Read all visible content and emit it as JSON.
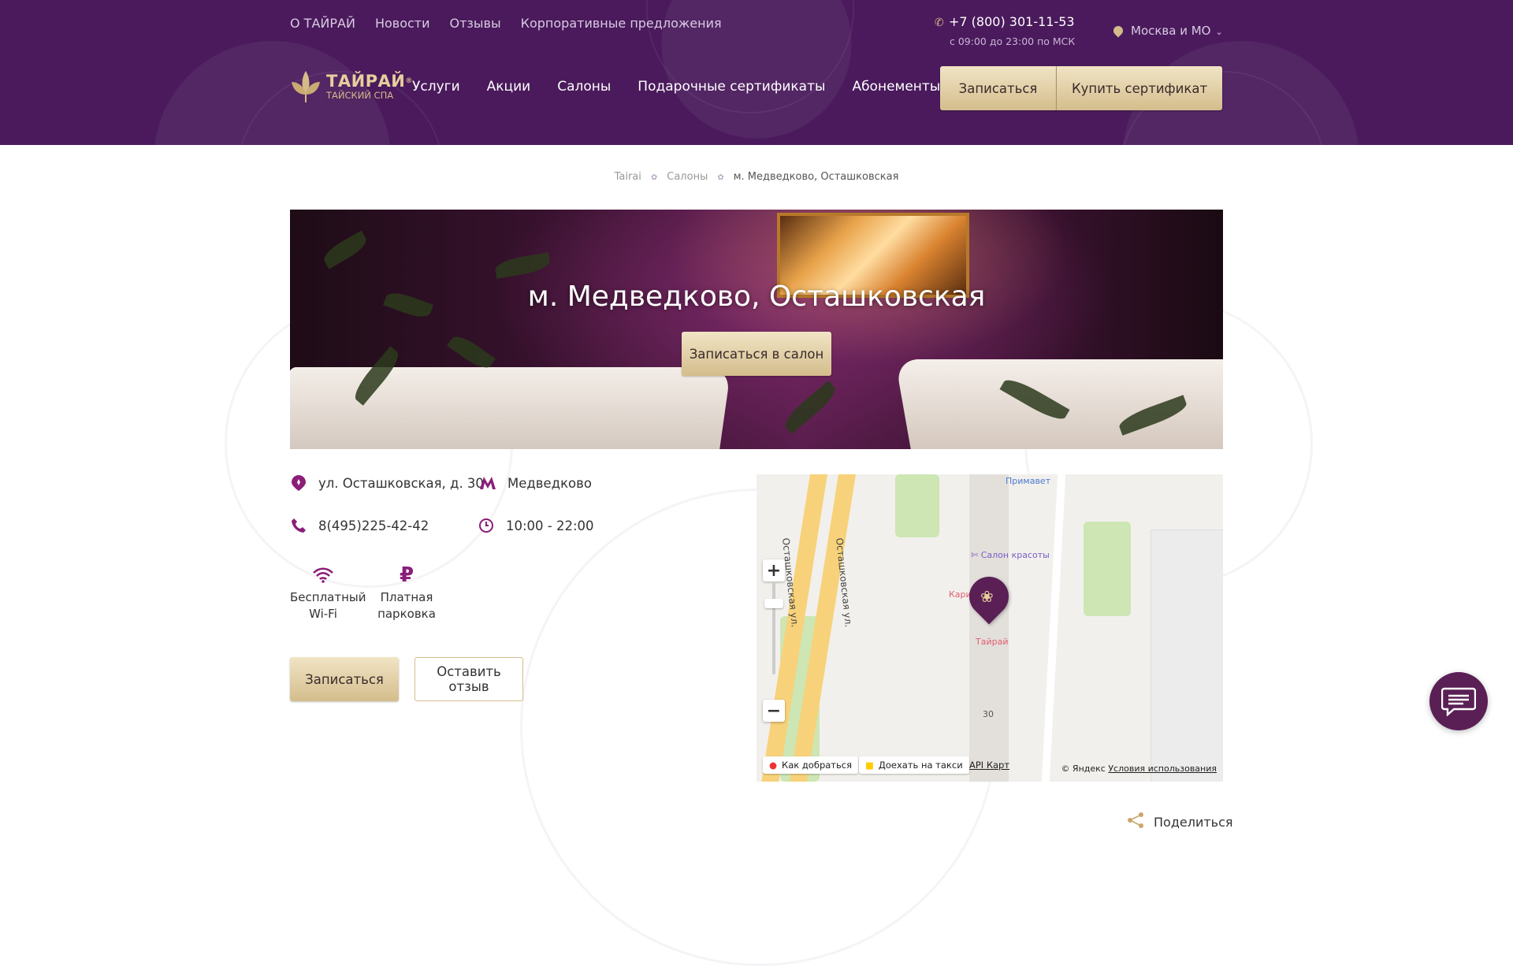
{
  "topnav": [
    "О ТАЙРАЙ",
    "Новости",
    "Отзывы",
    "Корпоративные предложения"
  ],
  "contact": {
    "phone": "+7 (800) 301-11-53",
    "hours": "с 09:00 до 23:00 по МСК",
    "region": "Москва и МО"
  },
  "logo": {
    "name": "ТАЙРАЙ",
    "tagline": "ТАЙСКИЙ СПА",
    "reg": "®"
  },
  "mainnav": [
    "Услуги",
    "Акции",
    "Салоны",
    "Подарочные сертификаты",
    "Абонементы"
  ],
  "header_buttons": {
    "book": "Записаться",
    "buy_certificate": "Купить сертификат"
  },
  "breadcrumb": {
    "items": [
      "Tairai",
      "Салоны"
    ],
    "current": "м. Медведково, Осташковская"
  },
  "hero": {
    "title": "м. Медведково, Осташковская",
    "button": "Записаться в салон"
  },
  "salon": {
    "address": "ул. Осташковская, д. 30",
    "metro": "Медведково",
    "phone": "8(495)225-42-42",
    "hours": "10:00 - 22:00"
  },
  "amenities": [
    {
      "icon": "wifi-icon",
      "line1": "Бесплатный",
      "line2": "Wi-Fi"
    },
    {
      "icon": "ruble-icon",
      "line1": "Платная",
      "line2": "парковка"
    }
  ],
  "actions": {
    "book": "Записаться",
    "review": "Оставить отзыв"
  },
  "map": {
    "street1": "Осташковская ул.",
    "street2": "Осташковская ул.",
    "poi_primavet": "Примавет",
    "poi_beauty": "Салон красоты",
    "poi_kari": "Кари",
    "poi_tairai": "Тайрай",
    "house": "30",
    "route": "Как добраться",
    "taxi": "Доехать на такси",
    "api": "API Карт",
    "copyright": "© Яндекс",
    "terms": "Условия использования"
  },
  "share": "Поделиться",
  "colors": {
    "purple": "#4a1a5c",
    "accent": "#8b1e79",
    "gold": "#d4bd8c"
  }
}
